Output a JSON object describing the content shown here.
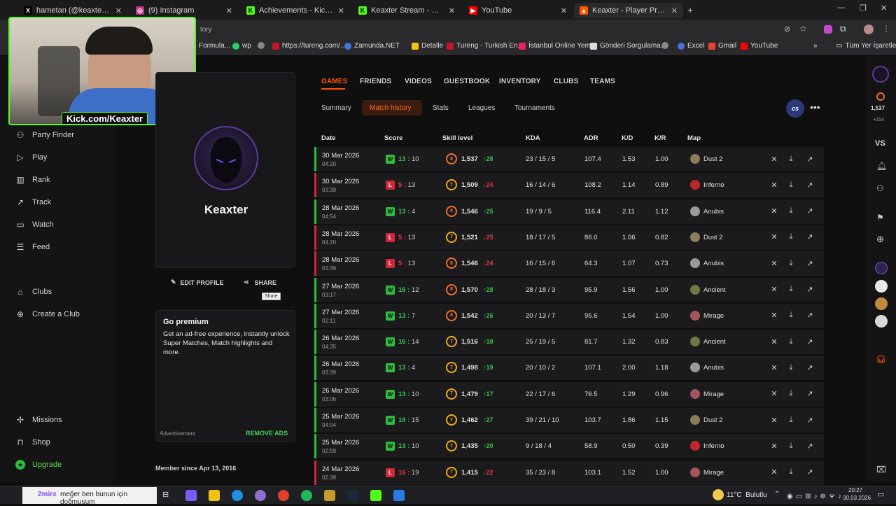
{
  "browser": {
    "tabs": [
      {
        "label": "hametan (@keaxter) adlı kullan",
        "icon": "x-icon",
        "color": "#000000"
      },
      {
        "label": "(9) Instagram",
        "icon": "instagram-icon",
        "color": "#c13584"
      },
      {
        "label": "Achievements - Kick Dashboard",
        "icon": "kick-icon",
        "color": "#53fc18"
      },
      {
        "label": "Keaxter Stream - Watch Live on",
        "icon": "kick-icon",
        "color": "#53fc18"
      },
      {
        "label": "YouTube",
        "icon": "youtube-icon",
        "color": "#ff0000"
      },
      {
        "label": "Keaxter - Player Profile - FACEI",
        "icon": "faceit-icon",
        "color": "#ff5500"
      }
    ],
    "address_text": "tory",
    "bookmarks": [
      {
        "label": "Formula..."
      },
      {
        "label": "wp"
      },
      {
        "label": "https://tureng.com/..."
      },
      {
        "label": "Zamunda.NET"
      },
      {
        "label": "Detalle"
      },
      {
        "label": "Tureng - Turkish En..."
      },
      {
        "label": "İstanbul Online Yem..."
      },
      {
        "label": "Gönderi Sorgulama..."
      },
      {
        "label": "Excel"
      },
      {
        "label": "Gmail"
      },
      {
        "label": "YouTube"
      }
    ],
    "bookmarks_other": "Tüm Yer İşaretleri"
  },
  "webcam": {
    "overlay_text": "Kick.com/Keaxter"
  },
  "sidebar": {
    "items": [
      {
        "label": "Party Finder",
        "icon": "party-icon"
      },
      {
        "label": "Play",
        "icon": "play-icon"
      },
      {
        "label": "Rank",
        "icon": "rank-icon"
      },
      {
        "label": "Track",
        "icon": "track-icon"
      },
      {
        "label": "Watch",
        "icon": "watch-icon"
      },
      {
        "label": "Feed",
        "icon": "feed-icon"
      },
      {
        "label": "Clubs",
        "icon": "clubs-icon"
      },
      {
        "label": "Create a Club",
        "icon": "plus-circle-icon"
      },
      {
        "label": "Missions",
        "icon": "missions-icon"
      },
      {
        "label": "Shop",
        "icon": "shop-icon"
      },
      {
        "label": "Upgrade",
        "icon": "upgrade-icon"
      }
    ]
  },
  "profile": {
    "name": "Keaxter",
    "edit_label": "EDIT PROFILE",
    "share_label": "SHARE",
    "tooltip": "Share",
    "member_since": "Member since Apr 13, 2016"
  },
  "premium": {
    "title": "Go premium",
    "body": "Get an ad-free experience, instantly unlock Super Matches, Match highlights and more.",
    "ad_label": "Advertisement",
    "remove_ads": "REMOVE ADS"
  },
  "main_tabs": [
    "GAMES",
    "FRIENDS",
    "VIDEOS",
    "GUESTBOOK",
    "INVENTORY",
    "CLUBS",
    "TEAMS"
  ],
  "sub_tabs": [
    "Summary",
    "Match history",
    "Stats",
    "Leagues",
    "Tournaments"
  ],
  "game_badge": "cs",
  "columns": [
    "Date",
    "Score",
    "Skill level",
    "KDA",
    "ADR",
    "K/D",
    "K/R",
    "Map"
  ],
  "matches": [
    {
      "date": "30 Mar 2026",
      "time": "04:20",
      "result": "W",
      "score": "13 : 10",
      "level": "8",
      "elo": "1,537",
      "delta": "28",
      "dir": "up",
      "kda": "23 / 15 / 5",
      "adr": "107.4",
      "kd": "1.53",
      "kr": "1.00",
      "map": "Dust 2"
    },
    {
      "date": "30 Mar 2026",
      "time": "03:39",
      "result": "L",
      "score": "5 : 13",
      "level": "7",
      "elo": "1,509",
      "delta": "24",
      "dir": "down",
      "kda": "16 / 14 / 6",
      "adr": "108.2",
      "kd": "1.14",
      "kr": "0.89",
      "map": "Inferno"
    },
    {
      "date": "28 Mar 2026",
      "time": "04:54",
      "result": "W",
      "score": "13 : 4",
      "level": "8",
      "elo": "1,546",
      "delta": "25",
      "dir": "up",
      "kda": "19 / 9 / 5",
      "adr": "116.4",
      "kd": "2.11",
      "kr": "1.12",
      "map": "Anubis"
    },
    {
      "date": "28 Mar 2026",
      "time": "04:20",
      "result": "L",
      "score": "5 : 13",
      "level": "7",
      "elo": "1,521",
      "delta": "25",
      "dir": "down",
      "kda": "18 / 17 / 5",
      "adr": "86.0",
      "kd": "1.06",
      "kr": "0.82",
      "map": "Dust 2"
    },
    {
      "date": "28 Mar 2026",
      "time": "03:39",
      "result": "L",
      "score": "5 : 13",
      "level": "8",
      "elo": "1,546",
      "delta": "24",
      "dir": "down",
      "kda": "16 / 15 / 6",
      "adr": "64.3",
      "kd": "1.07",
      "kr": "0.73",
      "map": "Anubis"
    },
    {
      "date": "27 Mar 2026",
      "time": "03:17",
      "result": "W",
      "score": "16 : 12",
      "level": "8",
      "elo": "1,570",
      "delta": "28",
      "dir": "up",
      "kda": "28 / 18 / 3",
      "adr": "95.9",
      "kd": "1.56",
      "kr": "1.00",
      "map": "Ancient"
    },
    {
      "date": "27 Mar 2026",
      "time": "02:11",
      "result": "W",
      "score": "13 : 7",
      "level": "8",
      "elo": "1,542",
      "delta": "26",
      "dir": "up",
      "kda": "20 / 13 / 7",
      "adr": "95.6",
      "kd": "1.54",
      "kr": "1.00",
      "map": "Mirage"
    },
    {
      "date": "26 Mar 2026",
      "time": "04:35",
      "result": "W",
      "score": "16 : 14",
      "level": "7",
      "elo": "1,516",
      "delta": "18",
      "dir": "up",
      "kda": "25 / 19 / 5",
      "adr": "81.7",
      "kd": "1.32",
      "kr": "0.83",
      "map": "Ancient"
    },
    {
      "date": "26 Mar 2026",
      "time": "03:39",
      "result": "W",
      "score": "13 : 4",
      "level": "7",
      "elo": "1,498",
      "delta": "19",
      "dir": "up",
      "kda": "20 / 10 / 2",
      "adr": "107.1",
      "kd": "2.00",
      "kr": "1.18",
      "map": "Anubis"
    },
    {
      "date": "26 Mar 2026",
      "time": "03:06",
      "result": "W",
      "score": "13 : 10",
      "level": "7",
      "elo": "1,479",
      "delta": "17",
      "dir": "up",
      "kda": "22 / 17 / 6",
      "adr": "76.5",
      "kd": "1.29",
      "kr": "0.96",
      "map": "Mirage"
    },
    {
      "date": "25 Mar 2026",
      "time": "04:04",
      "result": "W",
      "score": "19 : 15",
      "level": "7",
      "elo": "1,462",
      "delta": "27",
      "dir": "up",
      "kda": "39 / 21 / 10",
      "adr": "103.7",
      "kd": "1.86",
      "kr": "1.15",
      "map": "Dust 2"
    },
    {
      "date": "25 Mar 2026",
      "time": "02:59",
      "result": "W",
      "score": "13 : 10",
      "level": "7",
      "elo": "1,435",
      "delta": "20",
      "dir": "up",
      "kda": "9 / 18 / 4",
      "adr": "58.9",
      "kd": "0.50",
      "kr": "0.39",
      "map": "Inferno"
    },
    {
      "date": "24 Mar 2026",
      "time": "02:39",
      "result": "L",
      "score": "16 : 19",
      "level": "7",
      "elo": "1,415",
      "delta": "22",
      "dir": "down",
      "kda": "35 / 23 / 8",
      "adr": "103.1",
      "kd": "1.52",
      "kr": "1.00",
      "map": "Mirage"
    }
  ],
  "right_rail": {
    "elo": "1,537",
    "elo_delta": "+214",
    "vs": "VS"
  },
  "taskbar": {
    "chat_text": "meğer ben bunun için doğmuşum",
    "chat_user": "2mirx",
    "weather": "11°C  Bulutlu",
    "time": "20:27",
    "date": "30.03.2026"
  },
  "colors": {
    "accent": "#ff5500",
    "win": "#2ebd3b",
    "loss": "#d1283a",
    "kick": "#53fc18"
  }
}
